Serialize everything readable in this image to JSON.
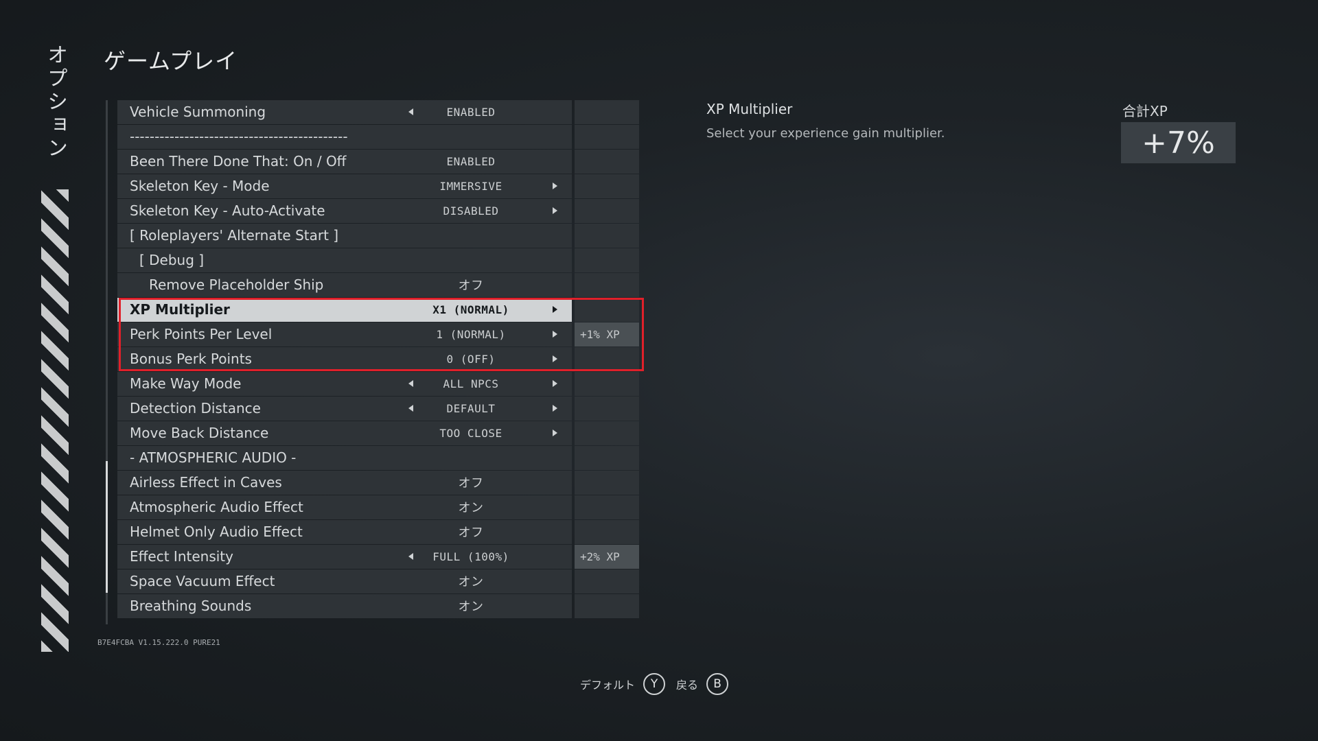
{
  "sidebar": {
    "vertical_title": "オプション"
  },
  "page_title": "ゲームプレイ",
  "rows": [
    {
      "label": "Vehicle Summoning",
      "value": "ENABLED",
      "side": "",
      "left_arrow": true,
      "right_arrow": false
    },
    {
      "label": "--------------------------------------------",
      "value": "",
      "side": "",
      "left_arrow": false,
      "right_arrow": false
    },
    {
      "label": "Been There Done That: On / Off",
      "value": "ENABLED",
      "side": "",
      "left_arrow": false,
      "right_arrow": false
    },
    {
      "label": "Skeleton Key - Mode",
      "value": "IMMERSIVE",
      "side": "",
      "left_arrow": false,
      "right_arrow": true
    },
    {
      "label": "Skeleton Key - Auto-Activate",
      "value": "DISABLED",
      "side": "",
      "left_arrow": false,
      "right_arrow": true
    },
    {
      "label": "[ Roleplayers' Alternate Start ]",
      "value": "",
      "side": "",
      "left_arrow": false,
      "right_arrow": false
    },
    {
      "label": "[ Debug ]",
      "value": "",
      "side": "",
      "left_arrow": false,
      "right_arrow": false
    },
    {
      "label": "Remove Placeholder Ship",
      "value": "オフ",
      "side": "",
      "left_arrow": false,
      "right_arrow": false
    },
    {
      "label": "XP Multiplier",
      "value": "X1 (NORMAL)",
      "side": "",
      "left_arrow": false,
      "right_arrow": true
    },
    {
      "label": "Perk Points Per Level",
      "value": "1 (NORMAL)",
      "side": "+1% XP",
      "left_arrow": false,
      "right_arrow": true
    },
    {
      "label": "Bonus Perk Points",
      "value": "0 (OFF)",
      "side": "",
      "left_arrow": false,
      "right_arrow": true
    },
    {
      "label": "Make Way Mode",
      "value": "ALL NPCS",
      "side": "",
      "left_arrow": true,
      "right_arrow": true
    },
    {
      "label": "Detection Distance",
      "value": "DEFAULT",
      "side": "",
      "left_arrow": true,
      "right_arrow": true
    },
    {
      "label": "Move Back Distance",
      "value": "TOO CLOSE",
      "side": "",
      "left_arrow": false,
      "right_arrow": true
    },
    {
      "label": "- ATMOSPHERIC AUDIO -",
      "value": "",
      "side": "",
      "left_arrow": false,
      "right_arrow": false
    },
    {
      "label": "Airless Effect in Caves",
      "value": "オフ",
      "side": "",
      "left_arrow": false,
      "right_arrow": false
    },
    {
      "label": "Atmospheric Audio Effect",
      "value": "オン",
      "side": "",
      "left_arrow": false,
      "right_arrow": false
    },
    {
      "label": "Helmet Only Audio Effect",
      "value": "オフ",
      "side": "",
      "left_arrow": false,
      "right_arrow": false
    },
    {
      "label": "Effect Intensity",
      "value": "FULL (100%)",
      "side": "+2% XP",
      "left_arrow": true,
      "right_arrow": false
    },
    {
      "label": "Space Vacuum Effect",
      "value": "オン",
      "side": "",
      "left_arrow": false,
      "right_arrow": false
    },
    {
      "label": "Breathing Sounds",
      "value": "オン",
      "side": "",
      "left_arrow": false,
      "right_arrow": false
    }
  ],
  "version": "B7E4FCBA V1.15.222.0 PURE21",
  "description": {
    "title": "XP Multiplier",
    "text": "Select your experience gain multiplier."
  },
  "xp_total": {
    "label": "合計XP",
    "value": "+7%"
  },
  "hints": {
    "default_label": "デフォルト",
    "default_button": "Y",
    "back_label": "戻る",
    "back_button": "B"
  }
}
